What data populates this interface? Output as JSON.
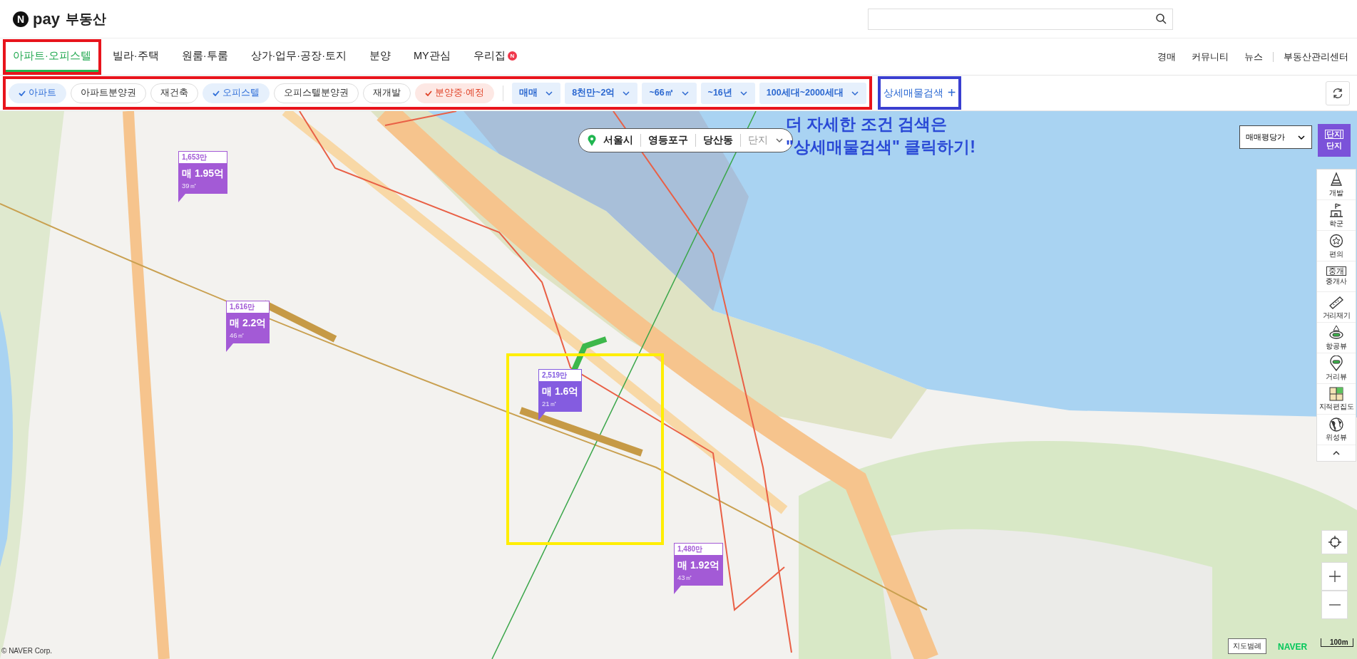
{
  "header": {
    "logo": {
      "mark": "N",
      "brand": "pay",
      "title": "부동산"
    }
  },
  "nav": {
    "tabs": [
      {
        "label": "아파트·오피스텔",
        "selected": true
      },
      {
        "label": "빌라·주택",
        "selected": false
      },
      {
        "label": "원룸·투룸",
        "selected": false
      },
      {
        "label": "상가·업무·공장·토지",
        "selected": false
      },
      {
        "label": "분양",
        "selected": false
      },
      {
        "label": "MY관심",
        "selected": false
      },
      {
        "label": "우리집",
        "selected": false,
        "badge": "N"
      }
    ],
    "links": [
      "경매",
      "커뮤니티",
      "뉴스",
      "부동산관리센터"
    ]
  },
  "filters": {
    "chips": [
      {
        "label": "아파트",
        "checked": true,
        "kind": "type"
      },
      {
        "label": "아파트분양권",
        "checked": false,
        "kind": "type"
      },
      {
        "label": "재건축",
        "checked": false,
        "kind": "type"
      },
      {
        "label": "오피스텔",
        "checked": true,
        "kind": "type"
      },
      {
        "label": "오피스텔분양권",
        "checked": false,
        "kind": "type"
      },
      {
        "label": "재개발",
        "checked": false,
        "kind": "type"
      },
      {
        "label": "분양중·예정",
        "checked": true,
        "kind": "status"
      }
    ],
    "dropdowns": [
      "매매",
      "8천만~2억",
      "~66㎡",
      "~16년",
      "100세대~2000세대"
    ],
    "detail_search": {
      "label": "상세매물검색",
      "icon": "+"
    }
  },
  "map": {
    "breadcrumb": [
      {
        "label": "서울시",
        "placeholder": false
      },
      {
        "label": "영등포구",
        "placeholder": false
      },
      {
        "label": "당산동",
        "placeholder": false
      },
      {
        "label": "단지",
        "placeholder": true
      }
    ],
    "markers": [
      {
        "count": "1,653만",
        "prefix": "매",
        "price": "1.95억",
        "area": "39㎡",
        "color": "#a35ad6"
      },
      {
        "count": "1,616만",
        "prefix": "매",
        "price": "2.2억",
        "area": "46㎡",
        "color": "#a35ad6"
      },
      {
        "count": "2,519만",
        "prefix": "매",
        "price": "1.6억",
        "area": "21㎡",
        "color": "#845ce0"
      },
      {
        "count": "1,480만",
        "prefix": "매",
        "price": "1.92억",
        "area": "43㎡",
        "color": "#a35ad6"
      }
    ],
    "annotation": [
      "더 자세한 조건 검색은",
      "\"상세매물검색\" 클릭하기!"
    ],
    "map_type_select": "매매평당가",
    "complex_button": {
      "icon_text": "단지",
      "label": "단지"
    },
    "tools": [
      {
        "label": "개발",
        "kind": "cone"
      },
      {
        "label": "학군",
        "kind": "school"
      },
      {
        "label": "편의",
        "kind": "star"
      },
      {
        "label": "중개사",
        "kind": "sign",
        "icon_text": "중개"
      },
      {
        "label": "거리재기",
        "kind": "ruler"
      },
      {
        "label": "항공뷰",
        "kind": "aerial"
      },
      {
        "label": "거리뷰",
        "kind": "pin"
      },
      {
        "label": "지적편집도",
        "kind": "cadastral"
      },
      {
        "label": "위성뷰",
        "kind": "globe"
      }
    ],
    "legend": "지도범례",
    "naver": "NAVER",
    "scale": "100m",
    "copyright": "© NAVER Corp."
  },
  "highlight_boxes": [
    {
      "color": "#e8141c"
    },
    {
      "color": "#e8141c"
    },
    {
      "color": "#3a3fd0"
    },
    {
      "color": "#ffee00"
    }
  ]
}
